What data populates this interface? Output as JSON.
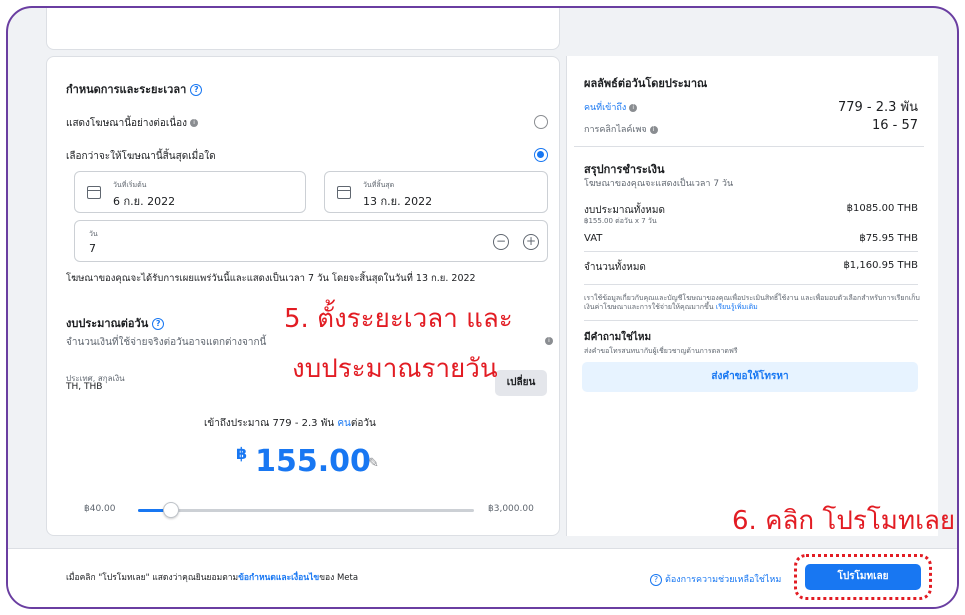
{
  "schedule": {
    "title": "กำหนดการและระยะเวลา",
    "continuous_label": "แสดงโฆษณานี้อย่างต่อเนื่อง",
    "choose_end_label": "เลือกว่าจะให้โฆษณานี้สิ้นสุดเมื่อใด",
    "start_label": "วันที่เริ่มต้น",
    "start_value": "6 ก.ย. 2022",
    "end_label": "วันที่สิ้นสุด",
    "end_value": "13 ก.ย. 2022",
    "days_label": "วัน",
    "days_value": "7",
    "summary": "โฆษณาของคุณจะได้รับการเผยแพร่วันนี้และแสดงเป็นเวลา 7 วัน โดยจะสิ้นสุดในวันที่ 13 ก.ย. 2022"
  },
  "budget": {
    "title": "งบประมาณต่อวัน",
    "note": "จำนวนเงินที่ใช้จ่ายจริงต่อวันอาจแตกต่างจากนี้",
    "country_label": "ประเทศ, สกุลเงิน",
    "country_value": "TH, THB",
    "change_label": "เปลี่ยน",
    "reach_prefix": "เข้าถึงประมาณ 779 - 2.3 พัน",
    "reach_link": "คน",
    "reach_suffix": "ต่อวัน",
    "currency_symbol": "฿",
    "amount": "155.00",
    "min_label": "฿40.00",
    "max_label": "฿3,000.00",
    "slider_fraction": 0.04
  },
  "overlays": {
    "step5_line1": "5. ตั้งระยะเวลา และ",
    "step5_line2": "งบประมาณรายวัน",
    "step6": "6. คลิก โปรโมทเลย"
  },
  "results": {
    "title": "ผลลัพธ์ต่อวันโดยประมาณ",
    "reach_label": "คนที่เข้าถึง",
    "reach_value": "779 - 2.3 พัน",
    "clicks_label": "การคลิกไลค์เพจ",
    "clicks_value": "16 - 57"
  },
  "payment": {
    "title": "สรุปการชำระเงิน",
    "subtitle": "โฆษณาของคุณจะแสดงเป็นเวลา 7 วัน",
    "total_budget_label": "งบประมาณทั้งหมด",
    "total_budget_sub": "฿155.00 ต่อวัน x 7 วัน",
    "total_budget_value": "฿1085.00 THB",
    "vat_label": "VAT",
    "vat_value": "฿75.95 THB",
    "grand_total_label": "จำนวนทั้งหมด",
    "grand_total_value": "฿1,160.95 THB",
    "disclaimer": "เราใช้ข้อมูลเกี่ยวกับคุณและบัญชีโฆษณาของคุณเพื่อประเมินสิทธิ์ใช้งาน และเพื่อมอบตัวเลือกสำหรับการเรียกเก็บเงินค่าโฆษณาและการใช้จ่ายให้คุณมากขึ้น",
    "learn_more": "เรียนรู้เพิ่มเติม"
  },
  "questions": {
    "title": "มีคำถามใช่ไหม",
    "subtitle": "ส่งคำขอโทรสนทนากับผู้เชี่ยวชาญด้านการตลาดฟรี",
    "request_label": "ส่งคำขอให้โทรหา"
  },
  "footer": {
    "terms_prefix": "เมื่อคลิก \"โปรโมทเลย\" แสดงว่าคุณยินยอมตาม",
    "terms_link": "ข้อกำหนดและเงื่อนไข",
    "terms_suffix": "ของ Meta",
    "help_label": "ต้องการความช่วยเหลือใช่ไหม",
    "promote_label": "โปรโมทเลย"
  },
  "colors": {
    "accent": "#1877f2",
    "annotation": "#e21c23",
    "frame": "#6a3ea1"
  }
}
